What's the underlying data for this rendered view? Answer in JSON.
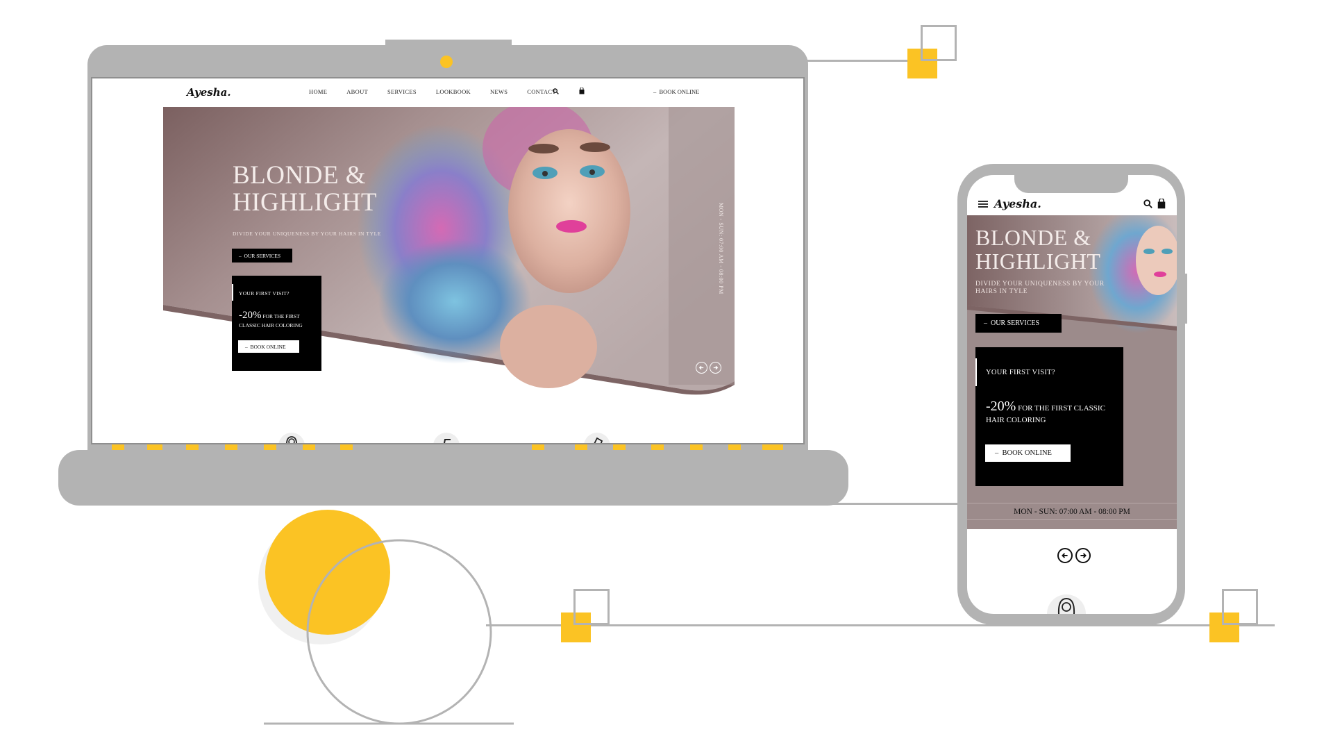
{
  "colors": {
    "accent": "#fbc324",
    "device_gray": "#b3b3b3",
    "hero_bg": "#9d8a8a",
    "black": "#000000"
  },
  "desktop": {
    "logo": "Ayesha.",
    "nav": [
      "HOME",
      "ABOUT",
      "SERVICES",
      "LOOKBOOK",
      "NEWS",
      "CONTACT"
    ],
    "search_icon": "search-icon",
    "cart_icon": "shopping-bag-icon",
    "book_online": "BOOK ONLINE",
    "hero": {
      "title_line1": "BLONDE &",
      "title_line2": "HIGHLIGHT",
      "subtitle": "DIVIDE YOUR UNIQUENESS BY YOUR HAIRS IN TYLE",
      "services_button": "OUR SERVICES",
      "promo_first_visit": "YOUR FIRST VISIT?",
      "promo_percent": "-20%",
      "promo_text": "FOR THE FIRST CLASSIC HAIR COLORING",
      "promo_button": "BOOK ONLINE",
      "hours": "MON - SUN: 07:00 AM - 08:00 PM"
    }
  },
  "mobile": {
    "logo": "Ayesha.",
    "menu_icon": "hamburger-menu-icon",
    "search_icon": "search-icon",
    "cart_icon": "shopping-bag-icon",
    "hero": {
      "title_line1": "BLONDE &",
      "title_line2": "HIGHLIGHT",
      "subtitle": "DIVIDE YOUR UNIQUENESS BY YOUR HAIRS IN TYLE",
      "services_button": "OUR SERVICES",
      "promo_first_visit": "YOUR FIRST VISIT?",
      "promo_percent": "-20%",
      "promo_text": "FOR THE FIRST CLASSIC HAIR COLORING",
      "promo_button": "BOOK ONLINE",
      "hours": "MON - SUN: 07:00 AM - 08:00 PM"
    }
  }
}
